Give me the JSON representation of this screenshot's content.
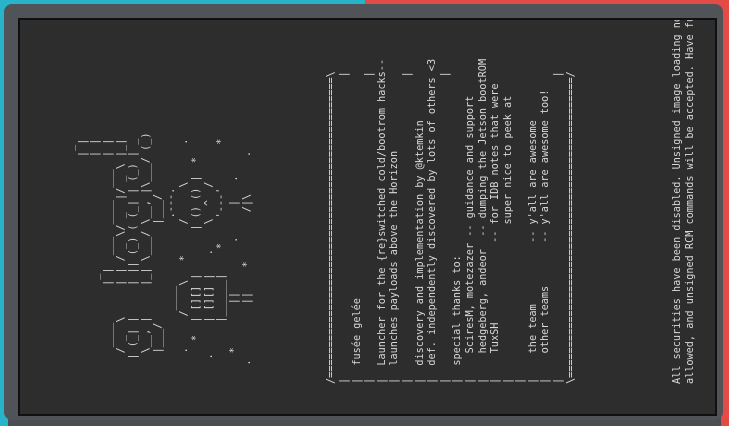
{
  "console": {
    "ascii_art": "                                      _\n                                     | |\n                 _                   | |\n      ____      | |  ___  ____  ___  | |\n     / _  \\     | | / _ \\/ _  |/ _ \\ |_|\n    | (_| |     | || (_) ( (_| | (_) | _\n     \\__, |     |_| \\___/ \\__, |\\___/ (_)\n     |___/                |___/\n            ____           .---.\n     .     /    \\   *     /     \\      .\n       *  | [][] |       | () () |  *\n    .     | [][] |   .    \\  ^  /\n          |______|    *    '---'       *\n     *       ||        .     |   .\n   .         ||    *        /|\\      .\n",
    "box": {
      "title": "fusée gelée",
      "description": [
        "Launcher for the {re}switched cold/bootrom hacks--",
        "launches payloads above the Horizon"
      ],
      "credits": [
        "discovery and implementation by @ktemkin",
        "def. independently discovered by lots of others <3"
      ],
      "thanks_heading": "special thanks to:",
      "thanks": [
        "SciresM, motezazer -- guidance and support",
        "hedgeberg, andeor  -- dumping the Jetson bootROM",
        "TuxSH             -- for IDB notes that were",
        "                     super nice to peek at",
        "",
        "the team          -- y'all are awesome",
        "other teams       -- y'all are awesome too!"
      ]
    },
    "footer": [
      "All securities have been disabled. Unsigned image loading now",
      "allowed, and unsigned RCM commands will be accepted. Have fun. :)"
    ]
  }
}
